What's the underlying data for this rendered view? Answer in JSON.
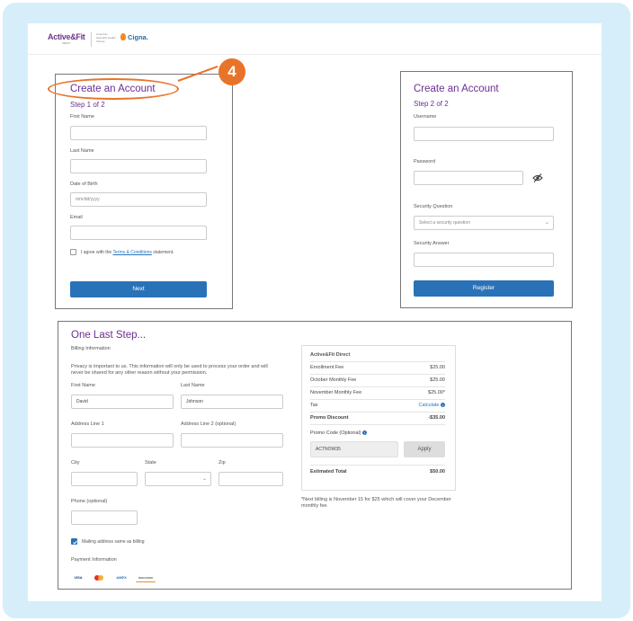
{
  "header": {
    "brand": "Active&Fit",
    "brand_sub": "DIRECT",
    "partner_text": "American Specialty Health Fitness",
    "partner_brand": "Cigna."
  },
  "callout": {
    "number": "4"
  },
  "step1": {
    "title": "Create an Account",
    "step": "Step 1 of 2",
    "first_name_label": "First Name",
    "last_name_label": "Last Name",
    "dob_label": "Date of Birth",
    "dob_placeholder": "mm/dd/yyyy",
    "email_label": "Email",
    "agree_prefix": "I agree with the",
    "agree_link": "Terms & Conditions",
    "agree_suffix": "statement.",
    "next_button": "Next"
  },
  "step2": {
    "title": "Create an Account",
    "step": "Step 2 of 2",
    "username_label": "Username",
    "password_label": "Password",
    "security_question_label": "Security Question",
    "security_question_placeholder": "Select a security question",
    "security_answer_label": "Security Answer",
    "register_button": "Register"
  },
  "last_step": {
    "title": "One Last Step...",
    "billing_heading": "Billing Information",
    "privacy_text": "Privacy is important to us. This information will only be used to process your order and will never be shared for any other reason without your permission.",
    "first_name_label": "First Name",
    "first_name_value": "David",
    "last_name_label": "Last Name",
    "last_name_value": "Johnson",
    "address1_label": "Address Line 1",
    "address2_label": "Address Line 2 (optional)",
    "city_label": "City",
    "state_label": "State",
    "zip_label": "Zip",
    "phone_label": "Phone (optional)",
    "mailing_same_label": "Mailing address same as billing",
    "payment_heading": "Payment Information",
    "cards": [
      "VISA",
      "MC",
      "AMEX",
      "DISCOVER"
    ]
  },
  "summary": {
    "heading": "Active&Fit Direct",
    "rows": [
      {
        "label": "Enrollment Fee",
        "value": "$25.00"
      },
      {
        "label": "October Monthly Fee",
        "value": "$25.00"
      },
      {
        "label": "November Monthly Fee",
        "value": "$25.00*"
      }
    ],
    "tax_label": "Tax",
    "tax_link": "Calculate",
    "promo_discount_label": "Promo Discount",
    "promo_discount_value": "-$35.00",
    "promo_code_label": "Promo Code (Optional)",
    "promo_code_value": "ACTNOW35",
    "apply_button": "Apply",
    "estimated_total_label": "Estimated Total",
    "estimated_total_value": "$50.00",
    "footnote": "*Next billing is November 15 for $25 which will cover your December monthly fee."
  },
  "colors": {
    "accent": "#6b2f92",
    "button": "#2a72b8",
    "callout": "#e8742a",
    "frame": "#d6eef9"
  }
}
